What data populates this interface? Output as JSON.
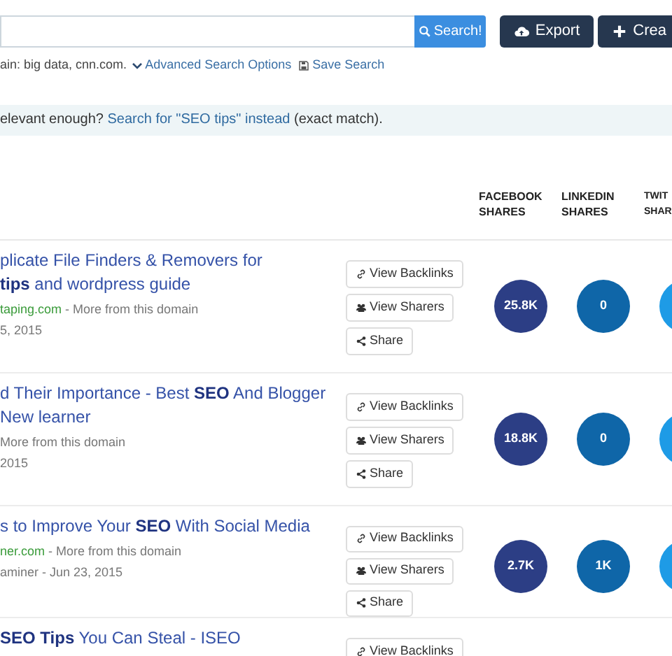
{
  "search": {
    "button": "Search!"
  },
  "actions": [
    {
      "kind": "export",
      "label": "Export"
    },
    {
      "kind": "create",
      "label": "Crea"
    }
  ],
  "options_line": {
    "text": "ain: big data, cnn.com.",
    "advanced": "Advanced Search Options",
    "save": "Save Search"
  },
  "alert": {
    "text": "elevant enough?",
    "link": "Search for \"SEO tips\" instead",
    "suffix": "(exact match)."
  },
  "columns": [
    {
      "label": "FACEBOOK SHARES",
      "color": "#2c3e85"
    },
    {
      "label": "LINKEDIN SHARES",
      "color": "#0f66a8"
    },
    {
      "label": "TWIT SHAR",
      "color": "#1e9be6"
    }
  ],
  "rows": [
    {
      "title": [
        "plicate File Finders & Removers for",
        "**tips** and wordpress guide"
      ],
      "domain": "taping.com",
      "more": "- More from this domain",
      "date": "5, 2015",
      "buttons": [
        "View Backlinks",
        "View Sharers",
        "Share"
      ],
      "shares": [
        "25.8K",
        "0"
      ]
    },
    {
      "title": [
        "d Their Importance - Best **SEO** And Blogger",
        "New learner"
      ],
      "more": "More from this domain",
      "date": "2015",
      "buttons": [
        "View Backlinks",
        "View Sharers",
        "Share"
      ],
      "shares": [
        "18.8K",
        "0"
      ]
    },
    {
      "title": [
        "s to Improve Your **SEO** With Social Media"
      ],
      "domain": "ner.com",
      "more": "- More from this domain",
      "date": "aminer - Jun 23, 2015",
      "buttons": [
        "View Backlinks",
        "View Sharers",
        "Share"
      ],
      "shares": [
        "2.7K",
        "1K"
      ]
    },
    {
      "title": [
        "**SEO Tips** You Can Steal - ISEO"
      ],
      "buttons": [
        "View Backlinks"
      ],
      "shares": []
    }
  ]
}
